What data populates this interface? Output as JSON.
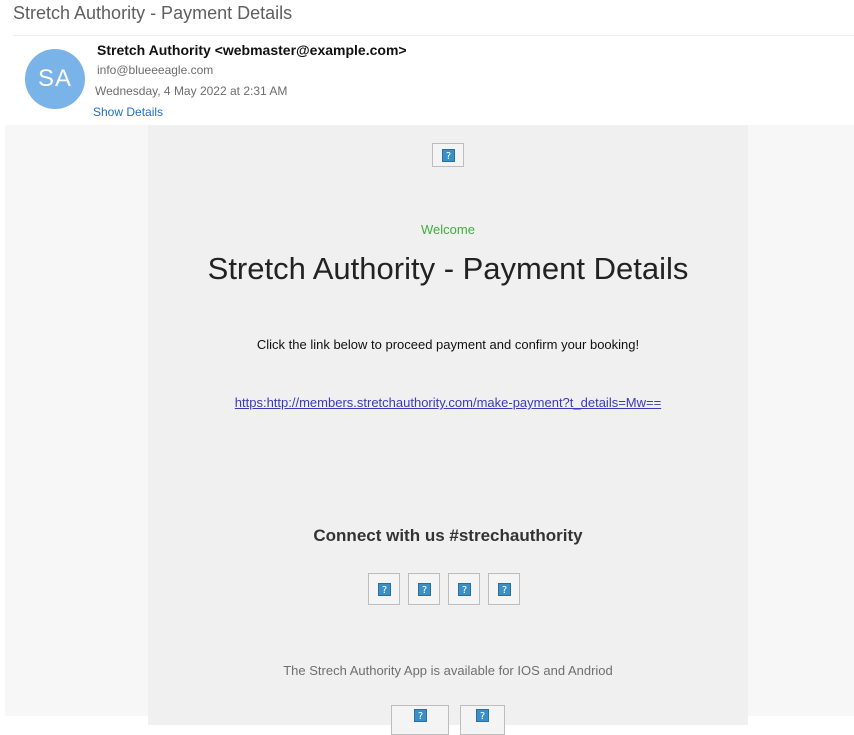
{
  "email": {
    "subject": "Stretch Authority - Payment Details",
    "avatar_initials": "SA",
    "avatar_color": "#7ab3e8",
    "from": "Stretch Authority <webmaster@example.com>",
    "to": "info@blueeeagle.com",
    "date": "Wednesday, 4 May 2022 at 2:31 AM",
    "show_details": "Show Details"
  },
  "content": {
    "welcome": "Welcome",
    "headline": "Stretch Authority - Payment Details",
    "instruction": "Click the link below to proceed payment and confirm your booking!",
    "link": "https:http://members.stretchauthority.com/make-payment?t_details=Mw==",
    "connect_heading": "Connect with us #strechauthority",
    "app_text": "The Strech Authority App is available for IOS and Andriod",
    "broken_image_glyph": "?",
    "accent_color": "#3fae3f",
    "link_color": "#3a3ab8"
  }
}
